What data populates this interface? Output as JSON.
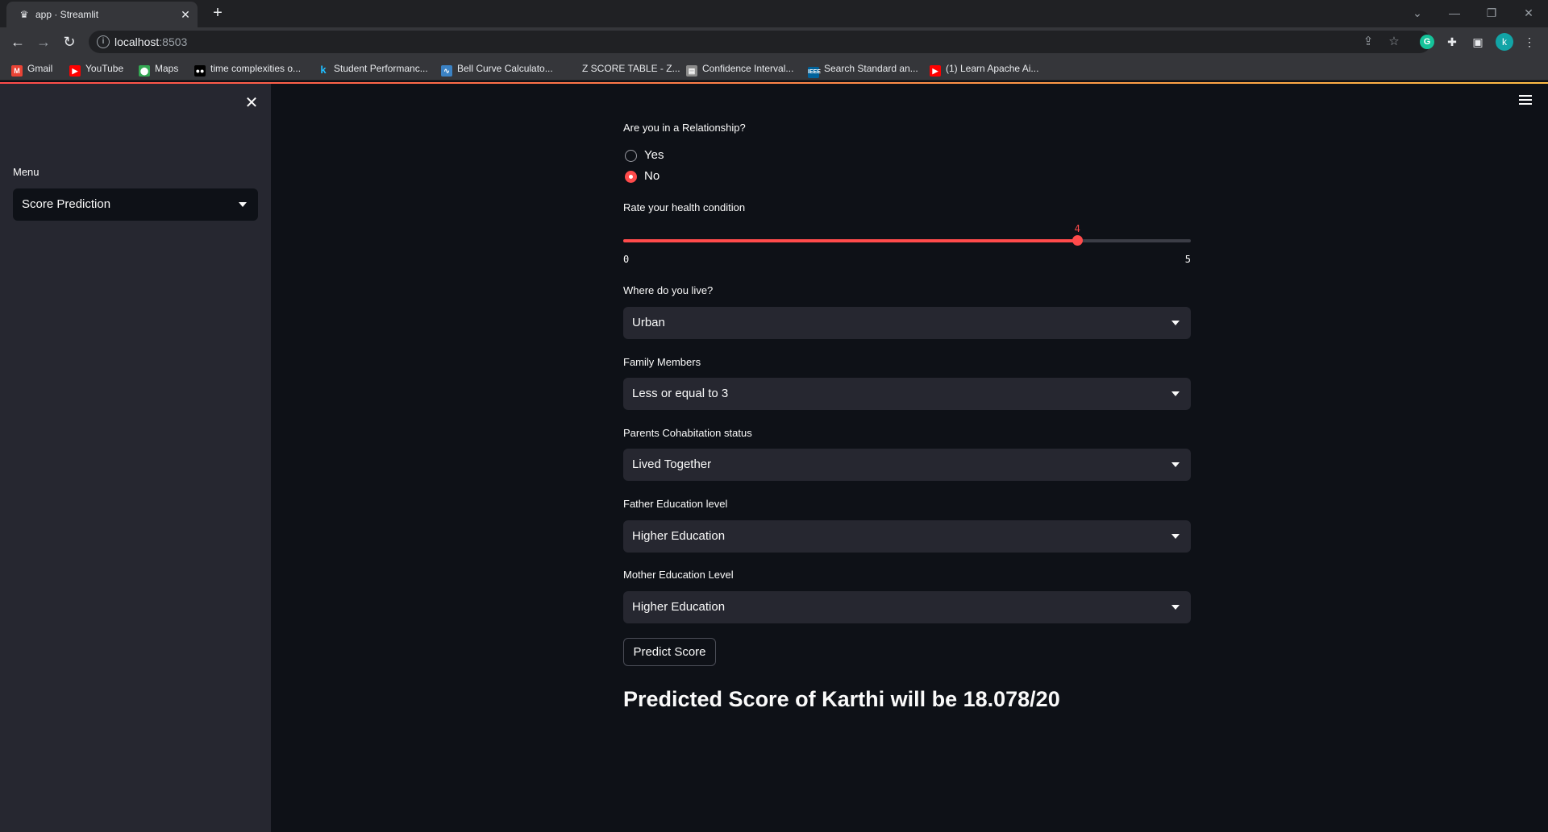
{
  "browser": {
    "tab_title": "app · Streamlit",
    "url_host": "localhost",
    "url_port": ":8503",
    "profile_initial": "k",
    "bookmarks": [
      {
        "label": "Gmail",
        "icon": "gmail-icon",
        "color": "#ea4335"
      },
      {
        "label": "YouTube",
        "icon": "youtube-icon",
        "color": "#ff0000"
      },
      {
        "label": "Maps",
        "icon": "maps-icon",
        "color": "#34a853"
      },
      {
        "label": "time complexities o...",
        "icon": "medium-icon",
        "color": "#000000"
      },
      {
        "label": "Student Performanc...",
        "icon": "kaggle-icon",
        "color": "#20beff"
      },
      {
        "label": "Bell Curve Calculato...",
        "icon": "calculator-icon",
        "color": "#3b82c4"
      },
      {
        "label": "Z SCORE TABLE - Z...",
        "icon": "zscore-icon",
        "color": "#35363a"
      },
      {
        "label": "Confidence Interval...",
        "icon": "chart-icon",
        "color": "#8a8a8a"
      },
      {
        "label": "Search Standard an...",
        "icon": "ieee-icon",
        "color": "#00629b"
      },
      {
        "label": "(1) Learn Apache Ai...",
        "icon": "youtube-icon",
        "color": "#ff0000"
      }
    ]
  },
  "sidebar": {
    "menu_label": "Menu",
    "menu_selected": "Score Prediction"
  },
  "form": {
    "relationship": {
      "label": "Are you in a Relationship?",
      "options": [
        "Yes",
        "No"
      ],
      "selected": "No"
    },
    "health": {
      "label": "Rate your health condition",
      "value": 4,
      "min": 0,
      "max": 5,
      "value_text": "4",
      "min_text": "0",
      "max_text": "5"
    },
    "address": {
      "label": "Where do you live?",
      "value": "Urban"
    },
    "family": {
      "label": "Family Members",
      "value": "Less or equal to 3"
    },
    "parents": {
      "label": "Parents Cohabitation status",
      "value": "Lived Together"
    },
    "father_edu": {
      "label": "Father Education level",
      "value": "Higher Education"
    },
    "mother_edu": {
      "label": "Mother Education Level",
      "value": "Higher Education"
    },
    "predict_button": "Predict Score"
  },
  "result_text": "Predicted Score of Karthi will be 18.078/20",
  "colors": {
    "accent": "#ff4b4b",
    "background": "#0e1117",
    "sidebar": "#262730"
  }
}
